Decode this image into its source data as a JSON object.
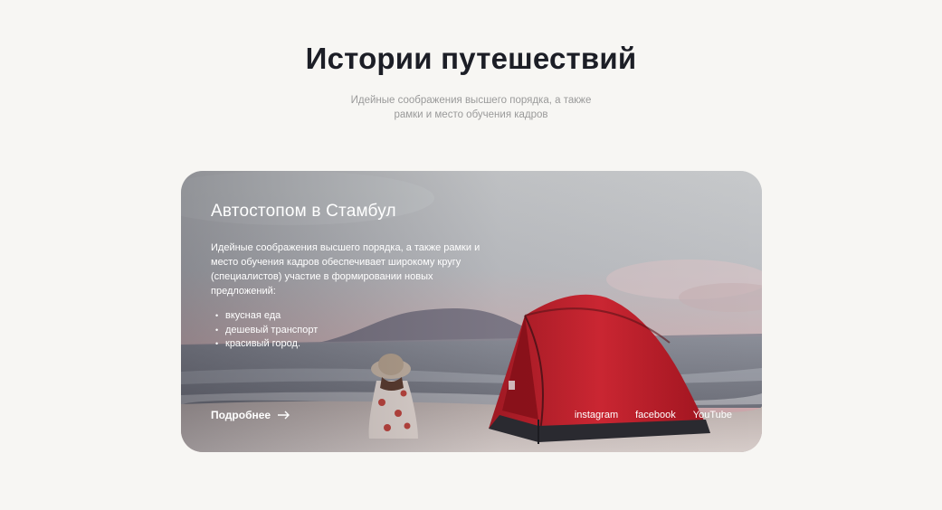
{
  "page": {
    "title": "Истории путешествий",
    "subtitle": "Идейные соображения высшего порядка, а также рамки и место обучения кадров"
  },
  "card": {
    "title": "Автостопом в Стамбул",
    "text": "Идейные соображения высшего порядка, а также рамки и место обучения кадров обеспечивает широкому кругу (специалистов) участие в формировании новых предложений:",
    "features": [
      "вкусная еда",
      "дешевый транспорт",
      "красивый город."
    ],
    "more_label": "Подробнее",
    "more_icon": "arrow-right-icon",
    "socials": [
      "instagram",
      "facebook",
      "YouTube"
    ],
    "image_alt_icons": [
      "tent-image",
      "woman-sitting-image",
      "mountain-image"
    ]
  },
  "colors": {
    "background": "#f7f6f3",
    "title": "#1c1e26",
    "subtitle": "#9a9a9a",
    "tent": "#c8222d",
    "card_text": "#ffffff"
  }
}
